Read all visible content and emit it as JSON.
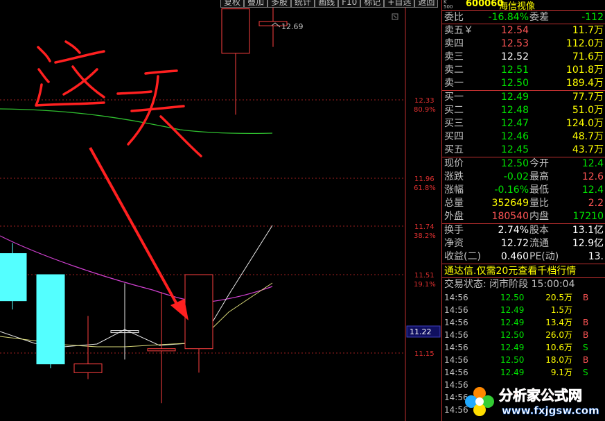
{
  "toolbar": [
    "复权",
    "叠加",
    "多股",
    "统计",
    "画线",
    "F10",
    "标记",
    "+自选",
    "返回"
  ],
  "chart_data": {
    "type": "candlestick",
    "y_axis_labels": [
      "12.33",
      "11.96",
      "11.74",
      "11.51",
      "11.15"
    ],
    "fib_levels": [
      "80.9%",
      "61.8%",
      "38.2%",
      "19.1%"
    ],
    "current_price_tag": "11.22",
    "high_annotation": "12.69",
    "handwriting": "这一天",
    "candles": [
      {
        "open": 11.39,
        "close": 11.61,
        "high": 11.66,
        "low": 11.35,
        "up": false
      },
      {
        "open": 11.51,
        "close": 11.1,
        "high": 11.51,
        "low": 11.08,
        "up": false
      },
      {
        "open": 11.1,
        "close": 11.06,
        "high": 11.32,
        "low": 11.03,
        "up": true
      },
      {
        "open": 11.25,
        "close": 11.25,
        "high": 11.47,
        "low": 11.12,
        "up": true
      },
      {
        "open": 11.16,
        "close": 11.17,
        "high": 11.43,
        "low": 10.92,
        "up": true
      },
      {
        "open": 11.17,
        "close": 11.51,
        "high": 11.51,
        "low": 11.06,
        "up": true
      },
      {
        "open": 12.55,
        "close": 12.76,
        "high": 12.76,
        "low": 12.26,
        "up": true
      },
      {
        "open": 12.68,
        "close": 12.7,
        "high": 12.98,
        "low": 12.58,
        "up": true
      }
    ]
  },
  "quote": {
    "code": "600060",
    "name": "海信视像",
    "tag_top": "K",
    "tag_bottom": "500",
    "webi_label": "委比",
    "webi_value": "-16.84%",
    "weicha_label": "委差",
    "weicha_value": "-112",
    "asks": [
      {
        "label": "卖五",
        "mark": "￥",
        "price": "12.54",
        "vol": "11.7万",
        "cls": "red"
      },
      {
        "label": "卖四",
        "mark": "",
        "price": "12.53",
        "vol": "112.0万",
        "cls": "red"
      },
      {
        "label": "卖三",
        "mark": "",
        "price": "12.52",
        "vol": "71.6万",
        "cls": "white"
      },
      {
        "label": "卖二",
        "mark": "",
        "price": "12.51",
        "vol": "101.8万",
        "cls": "green"
      },
      {
        "label": "卖一",
        "mark": "",
        "price": "12.50",
        "vol": "189.4万",
        "cls": "green"
      }
    ],
    "bids": [
      {
        "label": "买一",
        "price": "12.49",
        "vol": "77.7万"
      },
      {
        "label": "买二",
        "price": "12.48",
        "vol": "51.0万"
      },
      {
        "label": "买三",
        "price": "12.47",
        "vol": "124.0万"
      },
      {
        "label": "买四",
        "price": "12.46",
        "vol": "48.7万"
      },
      {
        "label": "买五",
        "price": "12.45",
        "vol": "43.7万"
      }
    ],
    "stats": [
      {
        "k": "现价",
        "v": "12.50",
        "vc": "green",
        "k2": "今开",
        "v2": "12.4",
        "v2c": "green"
      },
      {
        "k": "涨跌",
        "v": "-0.02",
        "vc": "green",
        "k2": "最高",
        "v2": "12.6",
        "v2c": "red"
      },
      {
        "k": "涨幅",
        "v": "-0.16%",
        "vc": "green",
        "k2": "最低",
        "v2": "12.4",
        "v2c": "green"
      },
      {
        "k": "总量",
        "v": "352649",
        "vc": "yellow",
        "k2": "量比",
        "v2": "2.2",
        "v2c": "red"
      },
      {
        "k": "外盘",
        "v": "180540",
        "vc": "red",
        "k2": "内盘",
        "v2": "17210",
        "v2c": "green"
      }
    ],
    "stats2": [
      {
        "k": "换手",
        "v": "2.74%",
        "vc": "white",
        "k2": "股本",
        "v2": "13.1亿",
        "v2c": "white"
      },
      {
        "k": "净资",
        "v": "12.72",
        "vc": "white",
        "k2": "流通",
        "v2": "12.9亿",
        "v2c": "white"
      },
      {
        "k": "收益(二)",
        "v": "0.460",
        "vc": "white",
        "k2": "PE(动)",
        "v2": "13.",
        "v2c": "white"
      }
    ],
    "ad_text": "通达信.仅需20元查看千档行情",
    "trade_state": "交易状态: 闭市阶段 15:00:04",
    "ticks": [
      {
        "t": "14:56",
        "p": "12.50",
        "pc": "green",
        "vol": "20.5万",
        "bs": "B",
        "bsc": "red"
      },
      {
        "t": "14:56",
        "p": "12.49",
        "pc": "green",
        "vol": "1.5万",
        "bs": "",
        "bsc": "red"
      },
      {
        "t": "14:56",
        "p": "12.49",
        "pc": "green",
        "vol": "13.4万",
        "bs": "B",
        "bsc": "red"
      },
      {
        "t": "14:56",
        "p": "12.50",
        "pc": "green",
        "vol": "26.0万",
        "bs": "B",
        "bsc": "red"
      },
      {
        "t": "14:56",
        "p": "12.49",
        "pc": "green",
        "vol": "10.6万",
        "bs": "S",
        "bsc": "green"
      },
      {
        "t": "14:56",
        "p": "12.50",
        "pc": "green",
        "vol": "18.0万",
        "bs": "B",
        "bsc": "red"
      },
      {
        "t": "14:56",
        "p": "12.49",
        "pc": "green",
        "vol": "9.1万",
        "bs": "S",
        "bsc": "green"
      },
      {
        "t": "14:56",
        "p": "",
        "pc": "green",
        "vol": "",
        "bs": "",
        "bsc": "red"
      },
      {
        "t": "14:56",
        "p": "",
        "pc": "green",
        "vol": "",
        "bs": "",
        "bsc": "red"
      },
      {
        "t": "14:56",
        "p": "",
        "pc": "green",
        "vol": "",
        "bs": "",
        "bsc": "red"
      }
    ]
  },
  "watermark": {
    "text": "分析家公式网",
    "url": "www.fxjgsw.com"
  }
}
